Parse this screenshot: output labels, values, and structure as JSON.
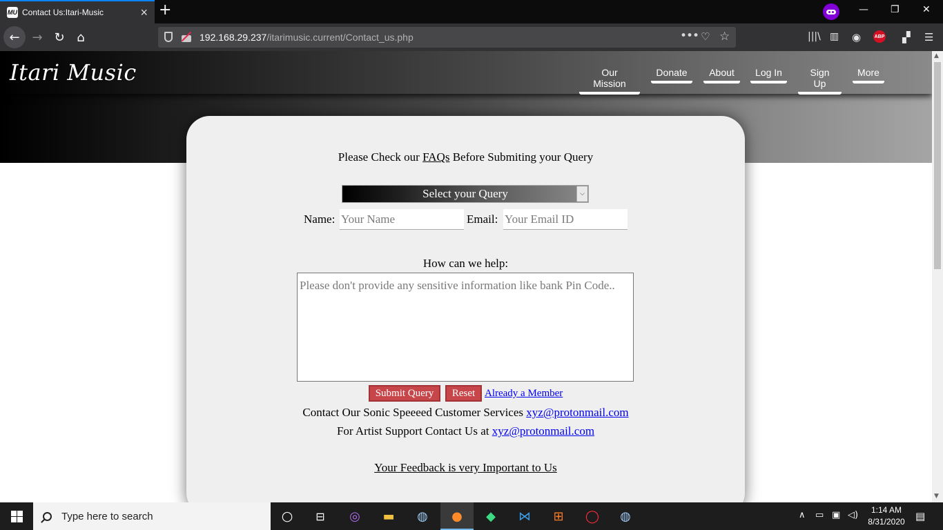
{
  "browser": {
    "tab_title": "Contact Us:Itari-Music",
    "tab_favicon": "MU",
    "url_host": "192.168.29.237",
    "url_path": "/itarimusic.current/Contact_us.php"
  },
  "site": {
    "logo": "Itari Music",
    "nav": [
      "Our Mission",
      "Donate",
      "About",
      "Log In",
      "Sign Up",
      "More"
    ]
  },
  "form": {
    "faq_prefix": "Please Check our ",
    "faq_link": "FAQs",
    "faq_suffix": " Before Submiting your Query",
    "select_value": "Select your Query",
    "name_label": "Name:",
    "name_placeholder": "Your Name",
    "email_label": "Email:",
    "email_placeholder": "Your Email ID",
    "help_label": "How can we help:",
    "help_placeholder": "Please don't provide any sensitive information like bank Pin Code..",
    "submit_label": "Submit Query",
    "reset_label": "Reset",
    "member_link": "Already a Member",
    "contact1_text": "Contact Our Sonic Speeeed Customer Services ",
    "contact1_email": "xyz@protonmail.com",
    "contact2_text": "For Artist Support Contact Us at ",
    "contact2_email": "xyz@protonmail.com",
    "feedback": "Your Feedback is very Important to Us"
  },
  "taskbar": {
    "search_placeholder": "Type here to search",
    "time": "1:14 AM",
    "date": "8/31/2020"
  },
  "colors": {
    "button_red": "#c7464a",
    "link_blue": "#0000ee",
    "private_purple": "#8000d7",
    "tab_accent": "#0a84ff"
  }
}
